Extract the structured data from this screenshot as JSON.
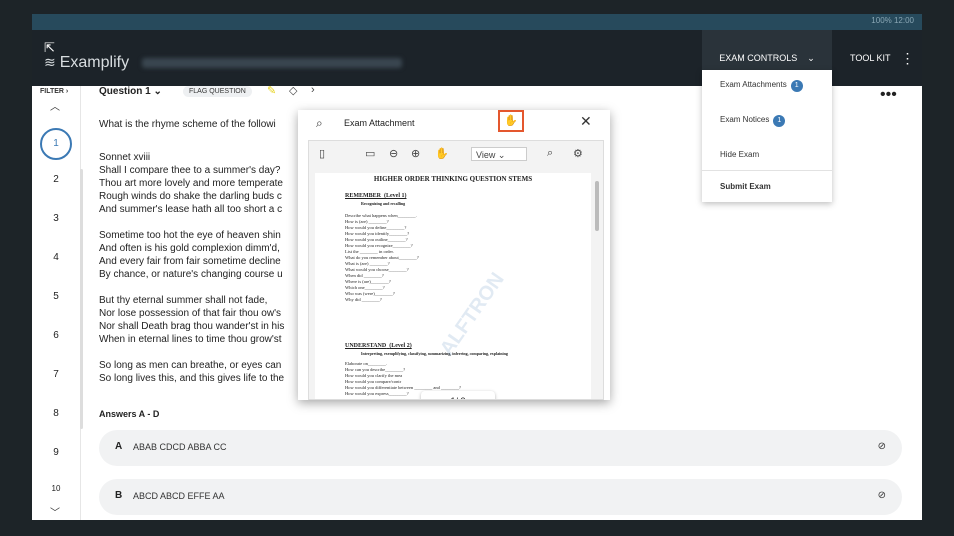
{
  "status": {
    "text": "100% 12:00"
  },
  "header": {
    "brand": "Examplify",
    "exam_controls_label": "EXAM CONTROLS",
    "toolkit_label": "TOOL KIT"
  },
  "sidebar": {
    "filter_label": "FILTER",
    "questions": [
      "1",
      "2",
      "3",
      "4",
      "5",
      "6",
      "7",
      "8",
      "9",
      "10"
    ]
  },
  "question_bar": {
    "title": "Question 1",
    "flag_label": "FLAG QUESTION"
  },
  "question": {
    "prompt": "What is the rhyme scheme of the followi",
    "lines": [
      "",
      "Sonnet xviii",
      "Shall I compare thee to a summer's day?",
      "Thou art more lovely and more temperate",
      "Rough winds do shake the darling buds c",
      "And summer's lease hath all too short a c",
      "",
      "Sometime too hot the eye of heaven shin",
      "And often is his gold complexion dimm'd,",
      "And every fair from fair sometime decline",
      "By chance, or nature's changing course u",
      "",
      "But thy eternal summer shall not fade,",
      "Nor lose possession of that fair thou ow's",
      "Nor shall Death brag thou wander'st in his",
      "When in eternal lines to time thou grow'st",
      "",
      "So long as men can breathe, or eyes can",
      "So long lives this, and this gives life to the"
    ]
  },
  "answers": {
    "label": "Answers A - D",
    "items": [
      {
        "letter": "A",
        "text": "ABAB CDCD ABBA CC"
      },
      {
        "letter": "B",
        "text": "ABCD ABCD EFFE AA"
      }
    ]
  },
  "dropdown": {
    "attachments_label": "Exam Attachments",
    "attachments_count": "1",
    "notices_label": "Exam Notices",
    "notices_count": "1",
    "hide_label": "Hide Exam",
    "submit_label": "Submit Exam"
  },
  "modal": {
    "title": "Exam Attachment",
    "view_select": "View",
    "page_current": "1",
    "page_total": "/ 3",
    "doc": {
      "title": "HIGHER ORDER THINKING QUESTION STEMS",
      "remember_head": "REMEMBER",
      "remember_level": "(Level 1)",
      "remember_sub": "Recognizing and recalling",
      "remember_lines": [
        "Describe what happens when________.",
        "How is (are) ________?",
        "How would you define________?",
        "How would you identify________?",
        "How would you outline________?",
        "How would you recognize________?",
        "List the ________ in order.",
        "What do you remember about________?",
        "What is (are) ________?",
        "What would you choose________?",
        "When did ________?",
        "Where is (are)________?",
        "Which one________?",
        "Who was (were)________?",
        "Why did ________?"
      ],
      "understand_head": "UNDERSTAND",
      "understand_level": "(Level 2)",
      "understand_sub": "Interpreting, exemplifying, classifying, summarizing, inferring, comparing, explaining",
      "understand_lines": [
        "Elaborate on________.",
        "How can you describe________?",
        "How would you clarify the mea",
        "How would you compare/contr",
        "How would you differentiate between ________ and ________?",
        "How would you express________?"
      ],
      "watermark": "ALFTRON"
    }
  },
  "colors": {
    "accent": "#3b79b4",
    "header_bg": "#1c2329",
    "highlight_box": "#e4572e"
  }
}
